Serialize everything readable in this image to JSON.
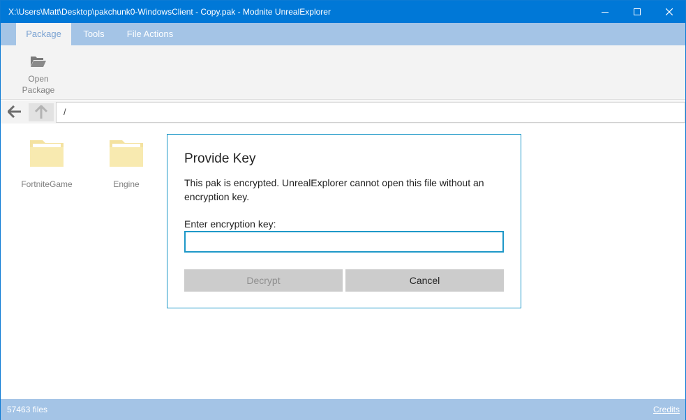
{
  "window": {
    "title": "X:\\Users\\Matt\\Desktop\\pakchunk0-WindowsClient - Copy.pak - Modnite UnrealExplorer",
    "controls": [
      "minimize-icon",
      "maximize-icon",
      "close-icon"
    ]
  },
  "ribbon": {
    "tabs": [
      {
        "label": "Package",
        "active": true
      },
      {
        "label": "Tools",
        "active": false
      },
      {
        "label": "File Actions",
        "active": false
      }
    ],
    "open_package": {
      "line1": "Open",
      "line2": "Package",
      "icon": "folder-open-icon"
    }
  },
  "nav": {
    "path": "/",
    "back_icon": "arrow-left-icon",
    "up_icon": "arrow-up-icon"
  },
  "folders": [
    {
      "label": "FortniteGame",
      "icon": "folder-icon"
    },
    {
      "label": "Engine",
      "icon": "folder-icon"
    }
  ],
  "dialog": {
    "title": "Provide Key",
    "message": "This pak is encrypted. UnrealExplorer cannot open this file without an encryption key.",
    "field_label": "Enter encryption key:",
    "field_value": "",
    "decrypt_label": "Decrypt",
    "cancel_label": "Cancel"
  },
  "status": {
    "file_count": "57463 files",
    "credits": "Credits"
  },
  "colors": {
    "titlebar": "#0078d7",
    "accent_light": "#a4c4e6",
    "dialog_border": "#1e98c8",
    "folder": "#f8e9a9"
  }
}
